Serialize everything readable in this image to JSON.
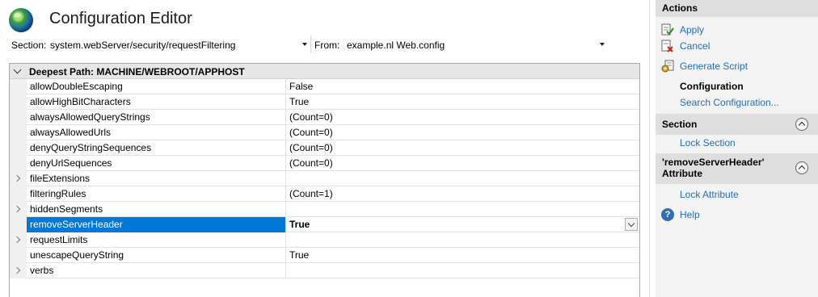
{
  "header": {
    "title": "Configuration Editor"
  },
  "toolbar": {
    "section_label": "Section:",
    "section_value": "system.webServer/security/requestFiltering",
    "from_label": "From:",
    "from_value": "example.nl Web.config"
  },
  "grid": {
    "header": "Deepest Path: MACHINE/WEBROOT/APPHOST",
    "rows": [
      {
        "name": "allowDoubleEscaping",
        "value": "False",
        "expandable": false
      },
      {
        "name": "allowHighBitCharacters",
        "value": "True",
        "expandable": false
      },
      {
        "name": "alwaysAllowedQueryStrings",
        "value": "(Count=0)",
        "expandable": false
      },
      {
        "name": "alwaysAllowedUrls",
        "value": "(Count=0)",
        "expandable": false
      },
      {
        "name": "denyQueryStringSequences",
        "value": "(Count=0)",
        "expandable": false
      },
      {
        "name": "denyUrlSequences",
        "value": "(Count=0)",
        "expandable": false
      },
      {
        "name": "fileExtensions",
        "value": "",
        "expandable": true
      },
      {
        "name": "filteringRules",
        "value": "(Count=1)",
        "expandable": false
      },
      {
        "name": "hiddenSegments",
        "value": "",
        "expandable": true
      },
      {
        "name": "removeServerHeader",
        "value": "True",
        "expandable": false,
        "selected": true
      },
      {
        "name": "requestLimits",
        "value": "",
        "expandable": true
      },
      {
        "name": "unescapeQueryString",
        "value": "True",
        "expandable": false
      },
      {
        "name": "verbs",
        "value": "",
        "expandable": true
      }
    ]
  },
  "actions": {
    "title": "Actions",
    "apply": "Apply",
    "cancel": "Cancel",
    "generate_script": "Generate Script",
    "configuration": "Configuration",
    "search_configuration": "Search Configuration...",
    "section_title": "Section",
    "lock_section": "Lock Section",
    "attribute_title_line1": "'removeServerHeader'",
    "attribute_title_line2": "Attribute",
    "lock_attribute": "Lock Attribute",
    "help": "Help"
  },
  "colors": {
    "selection": "#0078d7",
    "link": "#1e6fbf",
    "pane": "#f3f3f3"
  }
}
